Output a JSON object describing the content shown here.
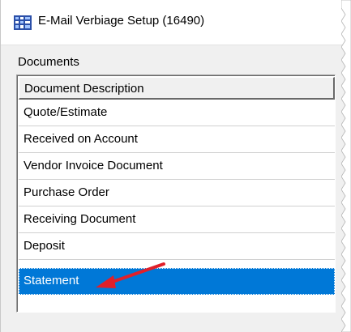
{
  "window": {
    "title": "E-Mail Verbiage Setup (16490)",
    "icon": "app-grid-icon"
  },
  "documents": {
    "group_label": "Documents",
    "column_header": "Document Description",
    "rows": [
      "Quote/Estimate",
      "Received on Account",
      "Vendor Invoice Document",
      "Purchase Order",
      "Receiving Document",
      "Deposit",
      "Statement"
    ],
    "selected": "Statement"
  },
  "colors": {
    "selection": "#0078d7",
    "annotation_arrow": "#e0202a"
  }
}
